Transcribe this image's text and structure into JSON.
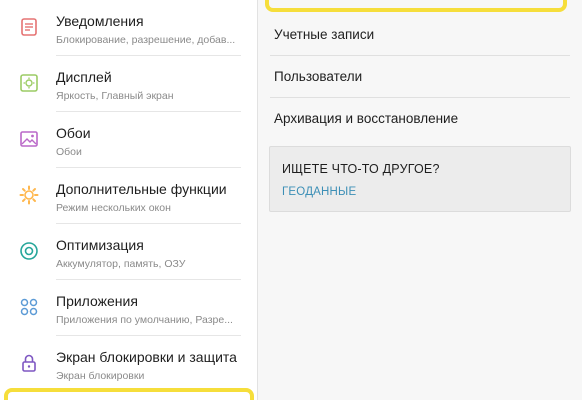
{
  "left_menu": {
    "items": [
      {
        "icon": "notifications-icon",
        "title": "Уведомления",
        "subtitle": "Блокирование, разрешение, добав...",
        "color": "#e57373"
      },
      {
        "icon": "display-icon",
        "title": "Дисплей",
        "subtitle": "Яркость, Главный экран",
        "color": "#9ccc65"
      },
      {
        "icon": "wallpaper-icon",
        "title": "Обои",
        "subtitle": "Обои",
        "color": "#ba68c8"
      },
      {
        "icon": "advanced-features-icon",
        "title": "Дополнительные функции",
        "subtitle": "Режим нескольких окон",
        "color": "#ffb74d"
      },
      {
        "icon": "optimization-icon",
        "title": "Оптимизация",
        "subtitle": "Аккумулятор, память, ОЗУ",
        "color": "#26a69a"
      },
      {
        "icon": "apps-icon",
        "title": "Приложения",
        "subtitle": "Приложения по умолчанию, Разре...",
        "color": "#5c9bd6"
      },
      {
        "icon": "lock-icon",
        "title": "Экран блокировки и защита",
        "subtitle": "Экран блокировки",
        "color": "#7e57c2"
      }
    ]
  },
  "right_panel": {
    "items": [
      {
        "title": "Учетные записи"
      },
      {
        "title": "Пользователи"
      },
      {
        "title": "Архивация и восстановление"
      }
    ],
    "card": {
      "title": "ИЩЕТЕ ЧТО-ТО ДРУГОЕ?",
      "link": "ГЕОДАННЫЕ"
    }
  },
  "colors": {
    "highlight": "#f6de3b",
    "link": "#3c8fb6"
  }
}
